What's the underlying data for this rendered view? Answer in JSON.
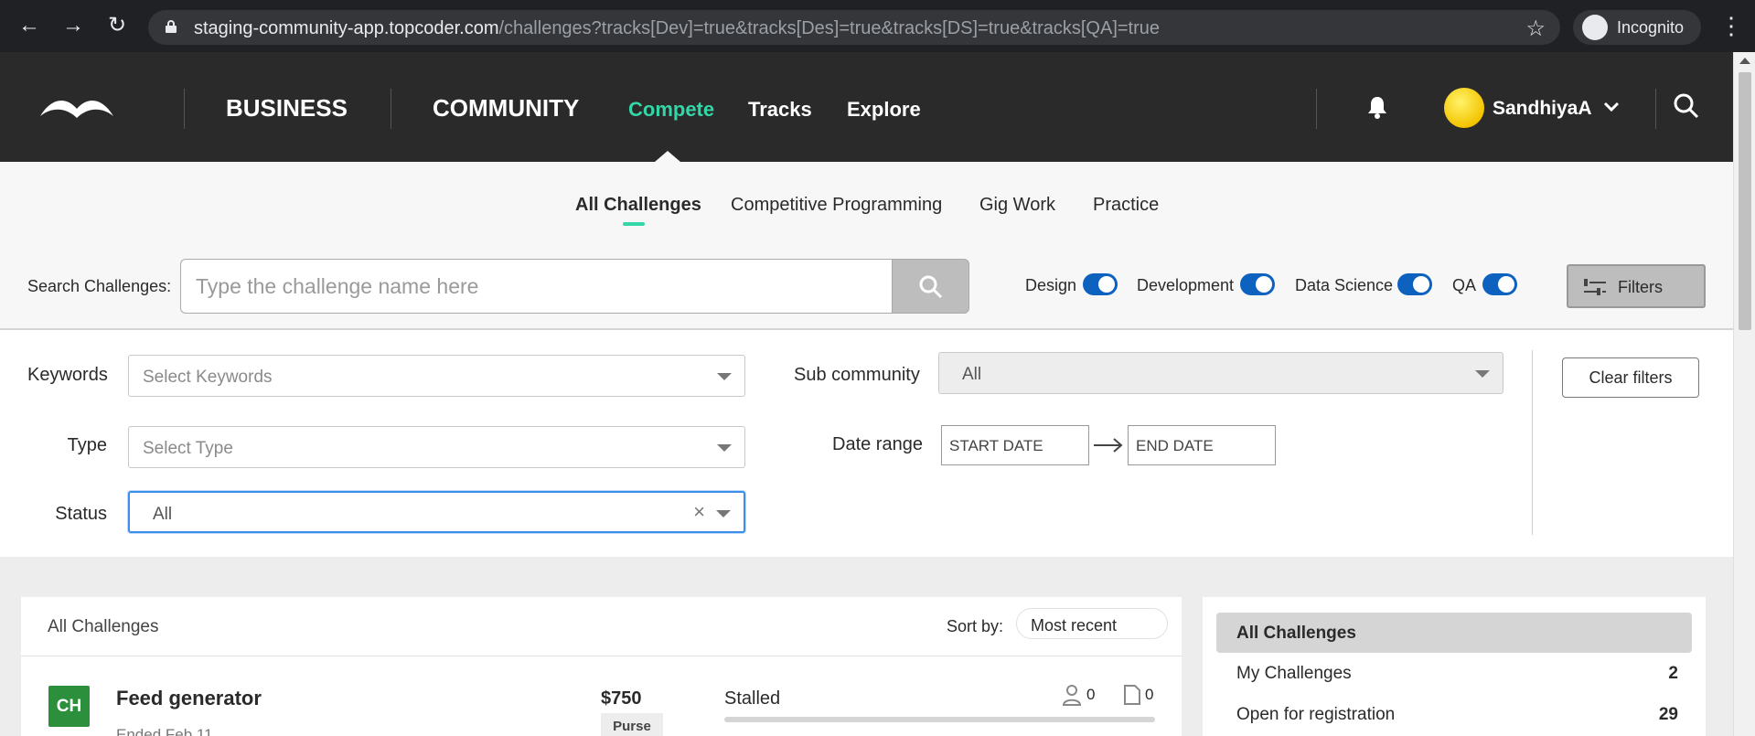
{
  "browser": {
    "url_host": "staging-community-app.topcoder.com",
    "url_path": "/challenges?tracks[Dev]=true&tracks[Des]=true&tracks[DS]=true&tracks[QA]=true",
    "profile_label": "Incognito"
  },
  "header": {
    "business": "BUSINESS",
    "community": "COMMUNITY",
    "nav": [
      "Compete",
      "Tracks",
      "Explore"
    ],
    "username": "SandhiyaA",
    "accent_color": "#33d6a6"
  },
  "tabs": [
    "All Challenges",
    "Competitive Programming",
    "Gig Work",
    "Practice"
  ],
  "search": {
    "label": "Search Challenges:",
    "placeholder": "Type the challenge name here"
  },
  "tracks": [
    {
      "label": "Design",
      "on": true
    },
    {
      "label": "Development",
      "on": true
    },
    {
      "label": "Data Science",
      "on": true
    },
    {
      "label": "QA",
      "on": true
    }
  ],
  "filters_button": "Filters",
  "filters": {
    "keywords_label": "Keywords",
    "keywords_placeholder": "Select Keywords",
    "type_label": "Type",
    "type_placeholder": "Select Type",
    "status_label": "Status",
    "status_value": "All",
    "subcommunity_label": "Sub community",
    "subcommunity_value": "All",
    "daterange_label": "Date range",
    "start_date": "START DATE",
    "end_date": "END DATE",
    "clear_label": "Clear filters"
  },
  "list": {
    "title": "All Challenges",
    "sort_label": "Sort by:",
    "sort_value": "Most recent",
    "rows": [
      {
        "badge": "CH",
        "name": "Feed generator",
        "ended": "Ended Feb 11",
        "prize": "$750",
        "prize_label": "Purse",
        "phase": "Stalled",
        "registrants": "0",
        "submissions": "0"
      }
    ]
  },
  "buckets": [
    {
      "label": "All Challenges",
      "count": ""
    },
    {
      "label": "My Challenges",
      "count": "2"
    },
    {
      "label": "Open for registration",
      "count": "29"
    }
  ]
}
